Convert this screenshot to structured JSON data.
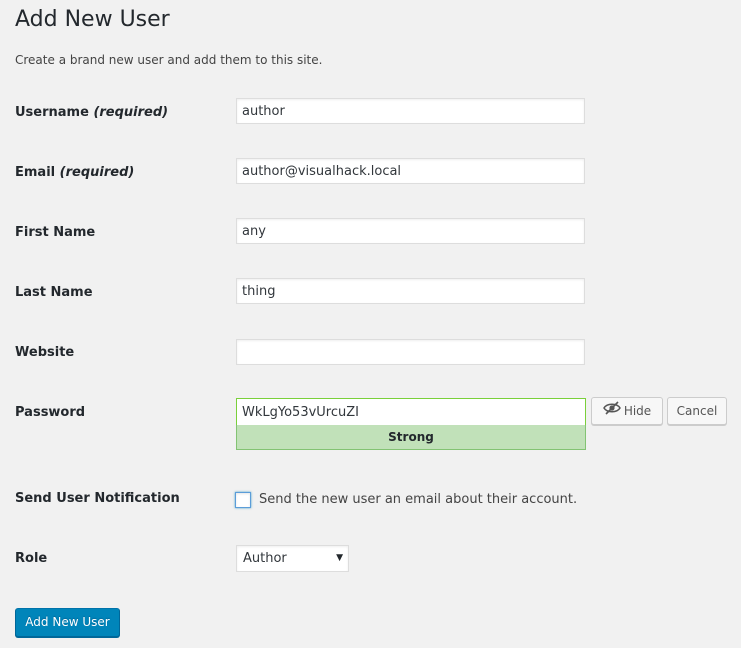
{
  "title": "Add New User",
  "description": "Create a brand new user and add them to this site.",
  "fields": {
    "username": {
      "label": "Username",
      "required": "(required)",
      "value": "author"
    },
    "email": {
      "label": "Email",
      "required": "(required)",
      "value": "author@visualhack.local"
    },
    "first_name": {
      "label": "First Name",
      "value": "any"
    },
    "last_name": {
      "label": "Last Name",
      "value": "thing"
    },
    "website": {
      "label": "Website",
      "value": ""
    },
    "password": {
      "label": "Password",
      "value": "WkLgYo53vUrcuZI",
      "strength": "Strong",
      "hide_label": "Hide",
      "cancel_label": "Cancel"
    },
    "notification": {
      "label": "Send User Notification",
      "checkbox_label": "Send the new user an email about their account.",
      "checked": false
    },
    "role": {
      "label": "Role",
      "selected": "Author"
    }
  },
  "submit_label": "Add New User",
  "icons": {
    "hide": "eye-slash-icon",
    "select": "triangle-down-icon"
  },
  "colors": {
    "primary": "#0085ba",
    "strength_bg": "#c1e1b9",
    "strength_border": "#83c373"
  }
}
